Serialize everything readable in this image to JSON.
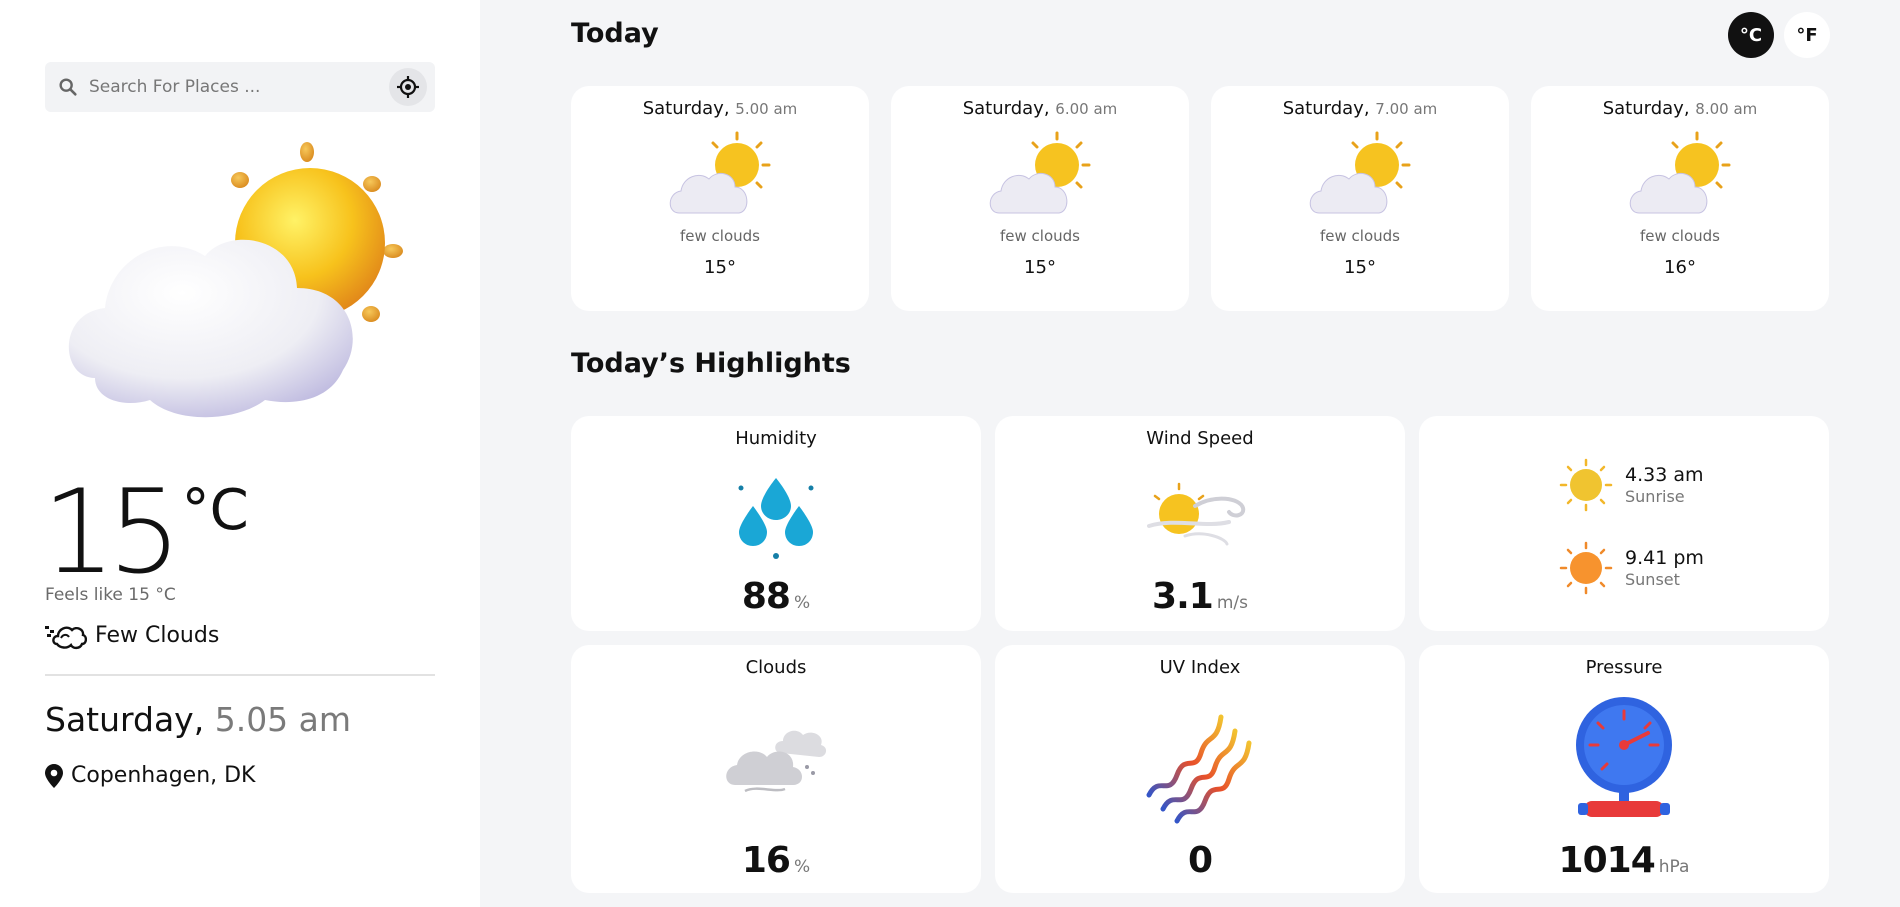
{
  "search": {
    "placeholder": "Search For Places ..."
  },
  "current": {
    "temp": "15",
    "unit": "°C",
    "feels_like": "Feels like 15 °C",
    "condition": "Few Clouds",
    "day": "Saturday,",
    "time": "5.05 am",
    "location": "Copenhagen, DK"
  },
  "units": {
    "celsius": "°C",
    "fahrenheit": "°F",
    "selected": "°C"
  },
  "today": {
    "title": "Today",
    "hours": [
      {
        "day": "Saturday,",
        "time": "5.00 am",
        "condition": "few clouds",
        "temp": "15°"
      },
      {
        "day": "Saturday,",
        "time": "6.00 am",
        "condition": "few clouds",
        "temp": "15°"
      },
      {
        "day": "Saturday,",
        "time": "7.00 am",
        "condition": "few clouds",
        "temp": "15°"
      },
      {
        "day": "Saturday,",
        "time": "8.00 am",
        "condition": "few clouds",
        "temp": "16°"
      }
    ]
  },
  "highlights": {
    "title": "Today’s Highlights",
    "humidity": {
      "label": "Humidity",
      "value": "88",
      "unit": "%"
    },
    "wind": {
      "label": "Wind Speed",
      "value": "3.1",
      "unit": "m/s"
    },
    "sun": {
      "sunrise_time": "4.33 am",
      "sunrise_label": "Sunrise",
      "sunset_time": "9.41 pm",
      "sunset_label": "Sunset"
    },
    "clouds": {
      "label": "Clouds",
      "value": "16",
      "unit": "%"
    },
    "uv": {
      "label": "UV Index",
      "value": "0"
    },
    "pressure": {
      "label": "Pressure",
      "value": "1014",
      "unit": "hPa"
    }
  },
  "colors": {
    "accent": "#111111",
    "sun": "#f5b400",
    "cloud": "#ecebf3",
    "water": "#1aa7d6",
    "gauge": "#2f63e0"
  }
}
